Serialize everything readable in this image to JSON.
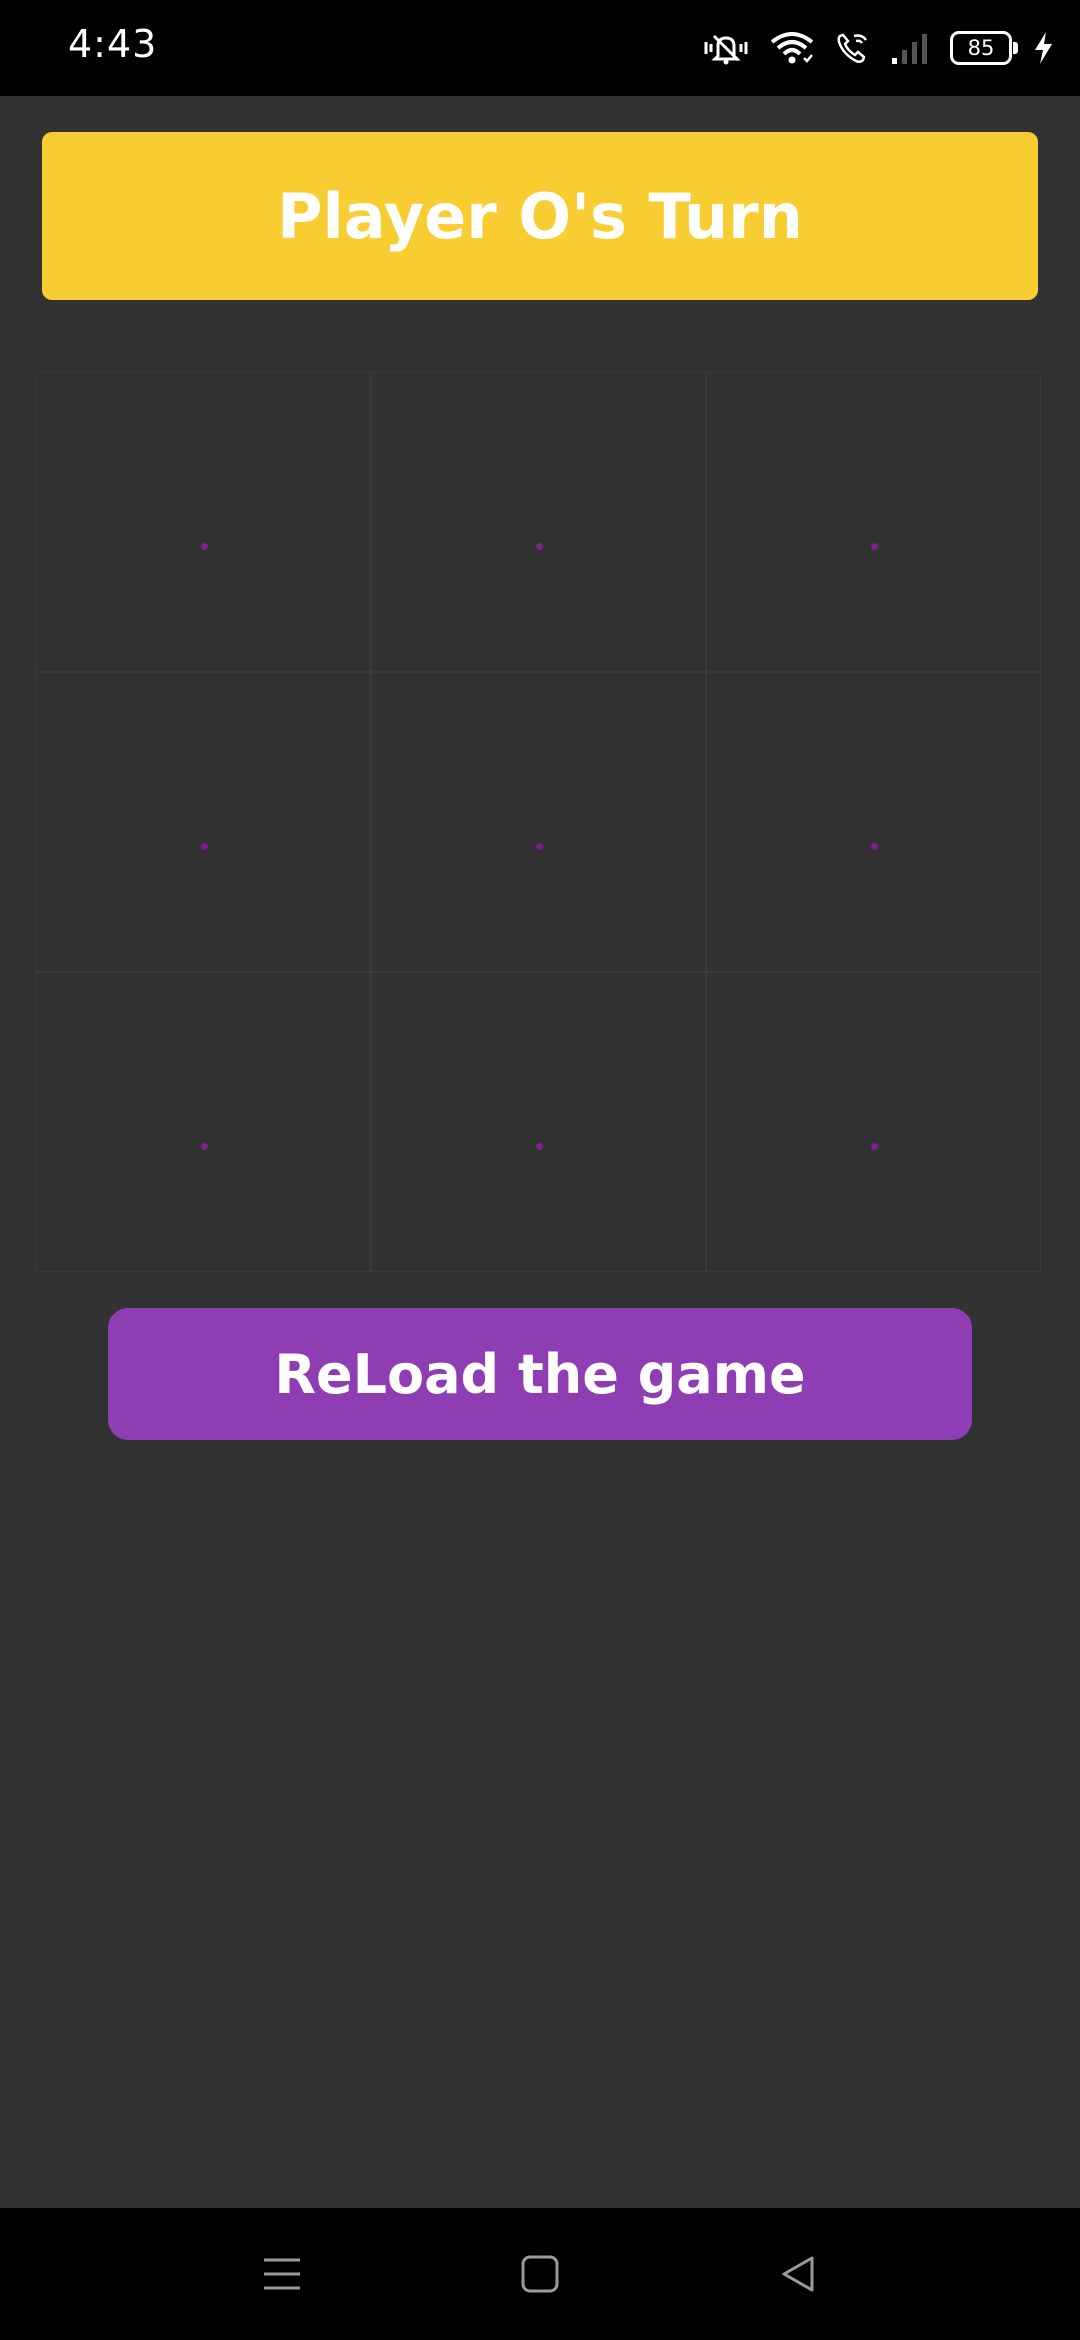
{
  "status_bar": {
    "time": "4:43",
    "battery_level": "85",
    "icons": [
      "vibrate-mute-icon",
      "wifi-icon",
      "wifi-calling-icon",
      "cell-signal-icon",
      "battery-icon",
      "charging-bolt-icon"
    ]
  },
  "game": {
    "turn_text": "Player O's Turn",
    "board": [
      "",
      "",
      "",
      "",
      "",
      "",
      "",
      "",
      ""
    ],
    "reload_label": "ReLoad the game"
  },
  "nav_bar": {
    "buttons": [
      "menu-icon",
      "home-icon",
      "back-icon"
    ]
  },
  "colors": {
    "background": "#323232",
    "banner": "#f7cd31",
    "reload_button": "#8e3db3",
    "cell_mark": "#7b1f8a"
  }
}
